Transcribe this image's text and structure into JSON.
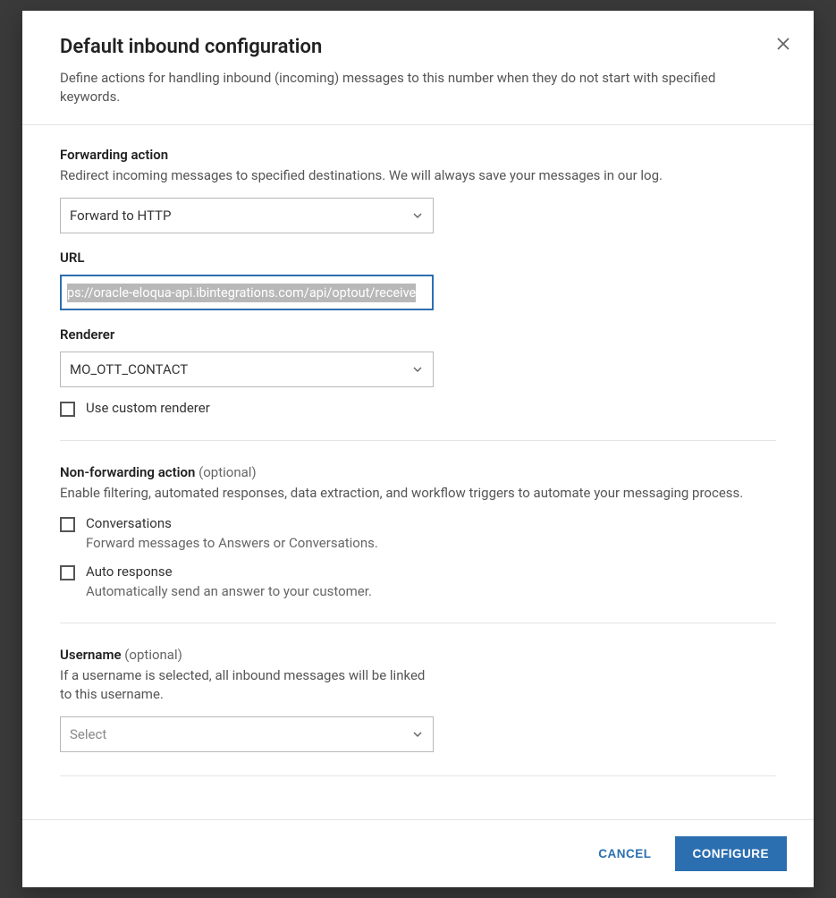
{
  "modal": {
    "title": "Default inbound configuration",
    "subtitle": "Define actions for handling inbound (incoming) messages to this number when they do not start with specified keywords."
  },
  "forwarding": {
    "title": "Forwarding action",
    "desc": "Redirect incoming messages to specified destinations. We will always save your messages in our log.",
    "action_value": "Forward to HTTP",
    "url_label": "URL",
    "url_value": "ps://oracle-eloqua-api.ibintegrations.com/api/optout/receive",
    "renderer_label": "Renderer",
    "renderer_value": "MO_OTT_CONTACT",
    "custom_renderer_label": "Use custom renderer"
  },
  "non_forwarding": {
    "title": "Non-forwarding action",
    "optional": " (optional)",
    "desc": "Enable filtering, automated responses, data extraction, and workflow triggers to automate your messaging process.",
    "conversations_label": "Conversations",
    "conversations_desc": "Forward messages to Answers or Conversations.",
    "autoresponse_label": "Auto response",
    "autoresponse_desc": "Automatically send an answer to your customer."
  },
  "username": {
    "title": "Username",
    "optional": " (optional)",
    "desc": "If a username is selected, all inbound messages will be linked to this username.",
    "placeholder": "Select"
  },
  "footer": {
    "cancel": "CANCEL",
    "configure": "CONFIGURE"
  }
}
